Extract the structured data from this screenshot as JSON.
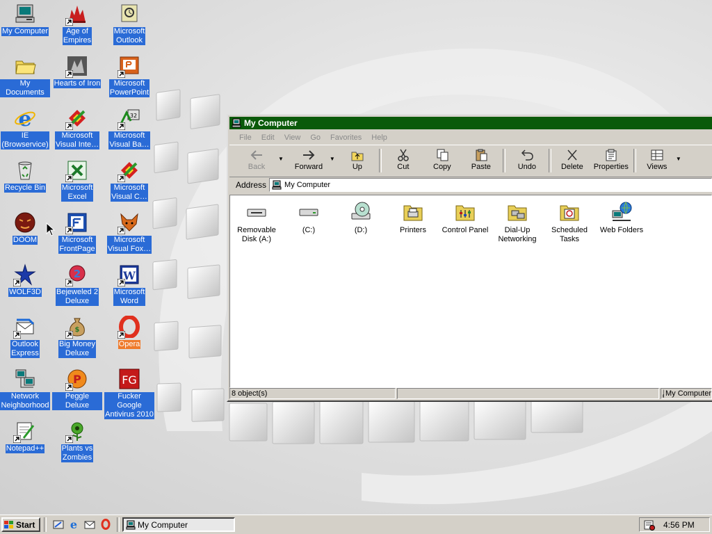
{
  "desktop": {
    "icons": [
      {
        "label": "My Computer",
        "icon": "my-computer-icon"
      },
      {
        "label": "Age of\nEmpires",
        "icon": "age-of-empires-icon"
      },
      {
        "label": "Microsoft\nOutlook",
        "icon": "outlook-icon"
      },
      {
        "label": "My Documents",
        "icon": "folder-icon"
      },
      {
        "label": "Hearts of Iron",
        "icon": "hearts-of-iron-icon"
      },
      {
        "label": "Microsoft\nPowerPoint",
        "icon": "powerpoint-icon"
      },
      {
        "label": "IE\n(Browservice)",
        "icon": "internet-explorer-icon"
      },
      {
        "label": "Microsoft\nVisual Inte…",
        "icon": "visual-studio-icon"
      },
      {
        "label": "Microsoft\nVisual Ba…",
        "icon": "visual-basic-icon"
      },
      {
        "label": "Recycle Bin",
        "icon": "recycle-bin-icon"
      },
      {
        "label": "Microsoft\nExcel",
        "icon": "excel-icon"
      },
      {
        "label": "Microsoft\nVisual C…",
        "icon": "visual-studio-icon"
      },
      {
        "label": "DOOM",
        "icon": "doom-icon"
      },
      {
        "label": "Microsoft\nFrontPage",
        "icon": "frontpage-icon"
      },
      {
        "label": "Microsoft\nVisual Fox…",
        "icon": "visual-foxpro-icon"
      },
      {
        "label": "WOLF3D",
        "icon": "wolf3d-icon"
      },
      {
        "label": "Bejeweled 2\nDeluxe",
        "icon": "bejeweled-icon"
      },
      {
        "label": "Microsoft\nWord",
        "icon": "word-icon"
      },
      {
        "label": "Outlook\nExpress",
        "icon": "outlook-express-icon"
      },
      {
        "label": "Big Money\nDeluxe",
        "icon": "money-bag-icon"
      },
      {
        "label": "Opera",
        "icon": "opera-icon"
      },
      {
        "label": "Network\nNeighborhood",
        "icon": "network-icon"
      },
      {
        "label": "Peggle Deluxe",
        "icon": "peggle-icon"
      },
      {
        "label": "Fucker Google\nAntivirus 2010",
        "icon": "antivirus-icon"
      },
      {
        "label": "Notepad++",
        "icon": "notepad-icon"
      },
      {
        "label": "Plants vs\nZombies",
        "icon": "plants-vs-zombies-icon"
      }
    ]
  },
  "window": {
    "title": "My Computer",
    "menu": [
      "File",
      "Edit",
      "View",
      "Go",
      "Favorites",
      "Help"
    ],
    "toolbar": {
      "back": "Back",
      "forward": "Forward",
      "up": "Up",
      "cut": "Cut",
      "copy": "Copy",
      "paste": "Paste",
      "undo": "Undo",
      "delete": "Delete",
      "properties": "Properties",
      "views": "Views"
    },
    "address": {
      "label": "Address",
      "value": "My Computer"
    },
    "items": [
      {
        "label": "Removable\nDisk (A:)",
        "icon": "floppy-drive-icon"
      },
      {
        "label": "(C:)",
        "icon": "hard-drive-icon"
      },
      {
        "label": "(D:)",
        "icon": "cd-drive-icon"
      },
      {
        "label": "Printers",
        "icon": "printers-folder-icon"
      },
      {
        "label": "Control Panel",
        "icon": "control-panel-folder-icon"
      },
      {
        "label": "Dial-Up\nNetworking",
        "icon": "dialup-folder-icon"
      },
      {
        "label": "Scheduled\nTasks",
        "icon": "scheduled-tasks-folder-icon"
      },
      {
        "label": "Web Folders",
        "icon": "web-folders-icon"
      }
    ],
    "status": {
      "count": "8 object(s)",
      "location": "My Computer"
    }
  },
  "taskbar": {
    "start": "Start",
    "task": "My Computer",
    "clock": "4:56 PM"
  },
  "colors": {
    "selection": "#2a6bd6",
    "titlebar": "#0a5a0a",
    "face": "#d4d0c8"
  }
}
